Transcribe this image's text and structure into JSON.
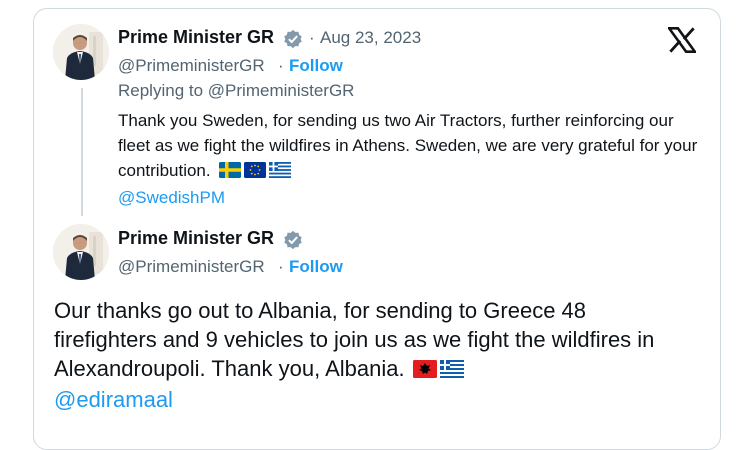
{
  "tweet_1": {
    "display_name": "Prime Minister GR",
    "separator": "·",
    "date": "Aug 23, 2023",
    "handle": "@PrimeministerGR",
    "dot": "·",
    "follow_label": "Follow",
    "replying_to_prefix": "Replying to",
    "replying_to_handle": "@PrimeministerGR",
    "text": "Thank you Sweden, for sending us two Air Tractors, further reinforcing our fleet as we fight the wildfires in Athens. Sweden, we are very grateful for your contribution.",
    "mention": "@SwedishPM",
    "flags": [
      "sweden-flag",
      "eu-flag",
      "greece-flag"
    ]
  },
  "tweet_2": {
    "display_name": "Prime Minister GR",
    "handle": "@PrimeministerGR",
    "dot": "·",
    "follow_label": "Follow",
    "text": "Our thanks go out to Albania, for sending to Greece 48 firefighters and 9 vehicles to join us as we fight the wildfires in Alexandroupoli. Thank you, Albania.",
    "mention": "@ediramaal",
    "flags": [
      "albania-flag",
      "greece-flag"
    ]
  },
  "icons": {
    "verified": "verified-badge-icon",
    "platform": "x-logo-icon"
  },
  "colors": {
    "link": "#1d9bf0",
    "muted": "#536471",
    "text": "#0f1419",
    "border": "#cfd9de",
    "verified_badge": "#829aab"
  }
}
